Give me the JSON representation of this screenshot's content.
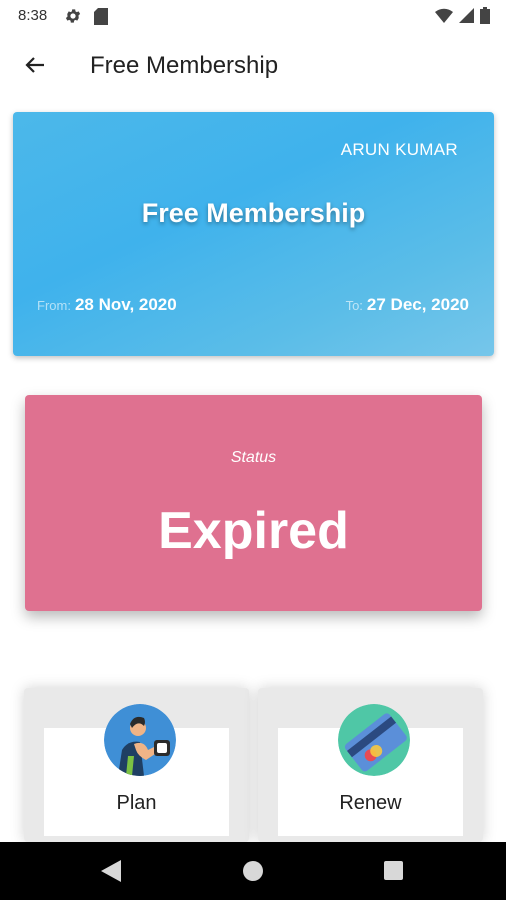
{
  "status_bar": {
    "time": "8:38",
    "icons": [
      "gear-icon",
      "sd-card-icon",
      "wifi-icon",
      "signal-icon",
      "battery-icon"
    ]
  },
  "app_bar": {
    "title": "Free Membership",
    "back_icon": "arrow-left-icon"
  },
  "membership_card": {
    "member_name": "ARUN KUMAR",
    "title": "Free Membership",
    "from_label": "From:",
    "from_date": "28 Nov, 2020",
    "to_label": "To:",
    "to_date": "27 Dec, 2020",
    "accent": "#3fb2ec"
  },
  "status_card": {
    "label": "Status",
    "value": "Expired",
    "color": "#df7190"
  },
  "tiles": [
    {
      "label": "Plan",
      "icon": "dumbbell-man-icon"
    },
    {
      "label": "Renew",
      "icon": "credit-card-icon"
    }
  ],
  "nav_bar": {
    "icons": [
      "back-triangle-icon",
      "home-circle-icon",
      "recents-square-icon"
    ]
  }
}
